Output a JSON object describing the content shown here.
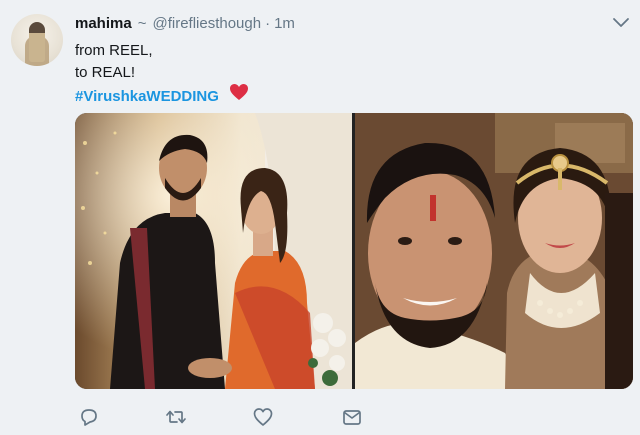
{
  "tweet": {
    "display_name": "mahima",
    "verified_suffix": "~",
    "handle": "@firefliesthough",
    "separator": "·",
    "timestamp": "1m",
    "lines": [
      "from REEL,",
      "to REAL!"
    ],
    "hashtag": "#VirushkaWEDDING",
    "emoji": "red-heart"
  },
  "colors": {
    "name": "#14171a",
    "secondary": "#657786",
    "hashtag": "#1b95e0",
    "heart": "#dd2e44",
    "background": "#eef1f4"
  },
  "media": {
    "photos": [
      "couple-photo-left",
      "couple-selfie-right"
    ]
  },
  "actions": {
    "icons": [
      "reply-icon",
      "retweet-icon",
      "like-icon",
      "direct-message-icon"
    ]
  }
}
